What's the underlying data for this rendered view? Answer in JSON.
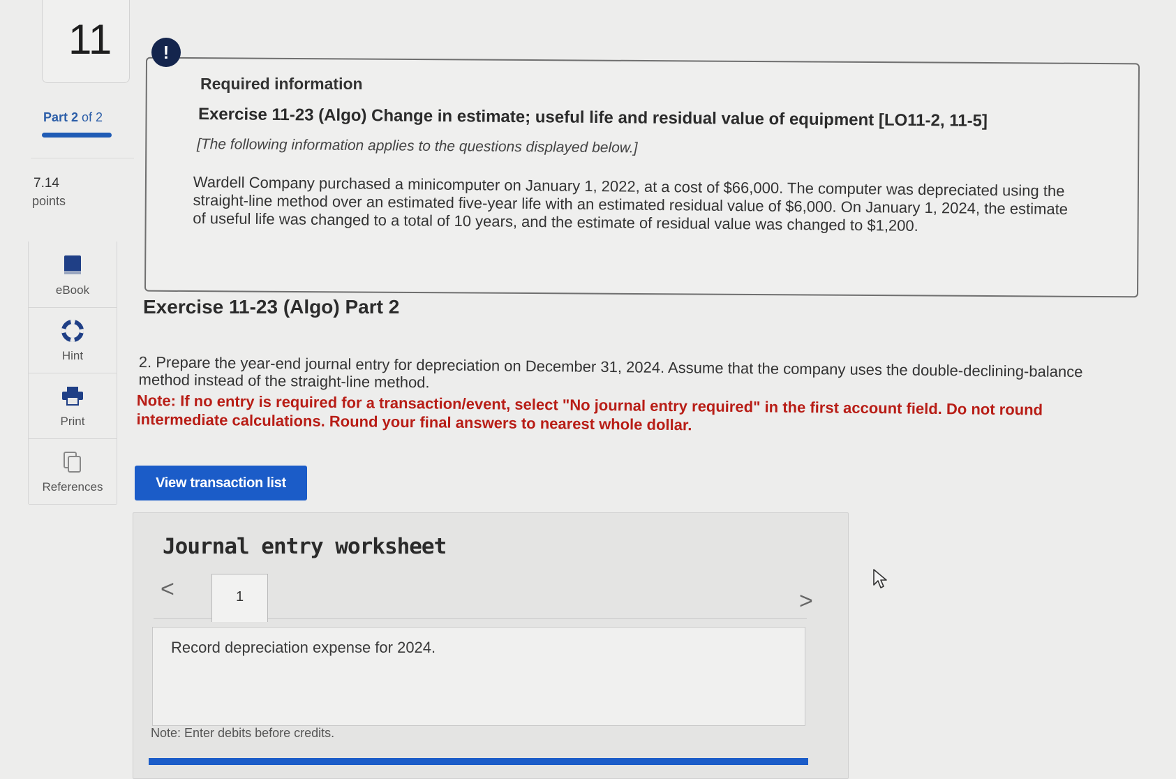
{
  "question_number": "11",
  "part": {
    "label_bold": "Part 2",
    "label_rest": " of 2"
  },
  "points": {
    "value": "7.14",
    "label": "points"
  },
  "tools": [
    {
      "label": "eBook",
      "icon": "book-icon"
    },
    {
      "label": "Hint",
      "icon": "lifebuoy-icon"
    },
    {
      "label": "Print",
      "icon": "printer-icon"
    },
    {
      "label": "References",
      "icon": "copy-icon"
    }
  ],
  "info": {
    "alert_symbol": "!",
    "heading": "Required information",
    "exercise_title": "Exercise 11-23 (Algo) Change in estimate; useful life and residual value of equipment [LO11-2, 11-5]",
    "subtitle": "[The following information applies to the questions displayed below.]",
    "scenario": "Wardell Company purchased a minicomputer on January 1, 2022, at a cost of $66,000. The computer was depreciated using the straight-line method over an estimated five-year life with an estimated residual value of $6,000. On January 1, 2024, the estimate of useful life was changed to a total of 10 years, and the estimate of residual value was changed to $1,200."
  },
  "part_title": "Exercise 11-23 (Algo) Part 2",
  "question": "2. Prepare the year-end journal entry for depreciation on December 31, 2024. Assume that the company uses the double-declining-balance method instead of the straight-line method.",
  "note": "Note: If no entry is required for a transaction/event, select \"No journal entry required\" in the first account field. Do not round intermediate calculations. Round your final answers to nearest whole dollar.",
  "view_button_label": "View transaction list",
  "worksheet": {
    "title": "Journal entry worksheet",
    "prev_symbol": "<",
    "next_symbol": ">",
    "tabs": [
      "1"
    ],
    "description": "Record depreciation expense for 2024.",
    "note": "Note: Enter debits before credits."
  },
  "colors": {
    "accent_blue": "#1b5cc8",
    "note_red": "#b81d16",
    "alert_navy": "#14254d"
  }
}
